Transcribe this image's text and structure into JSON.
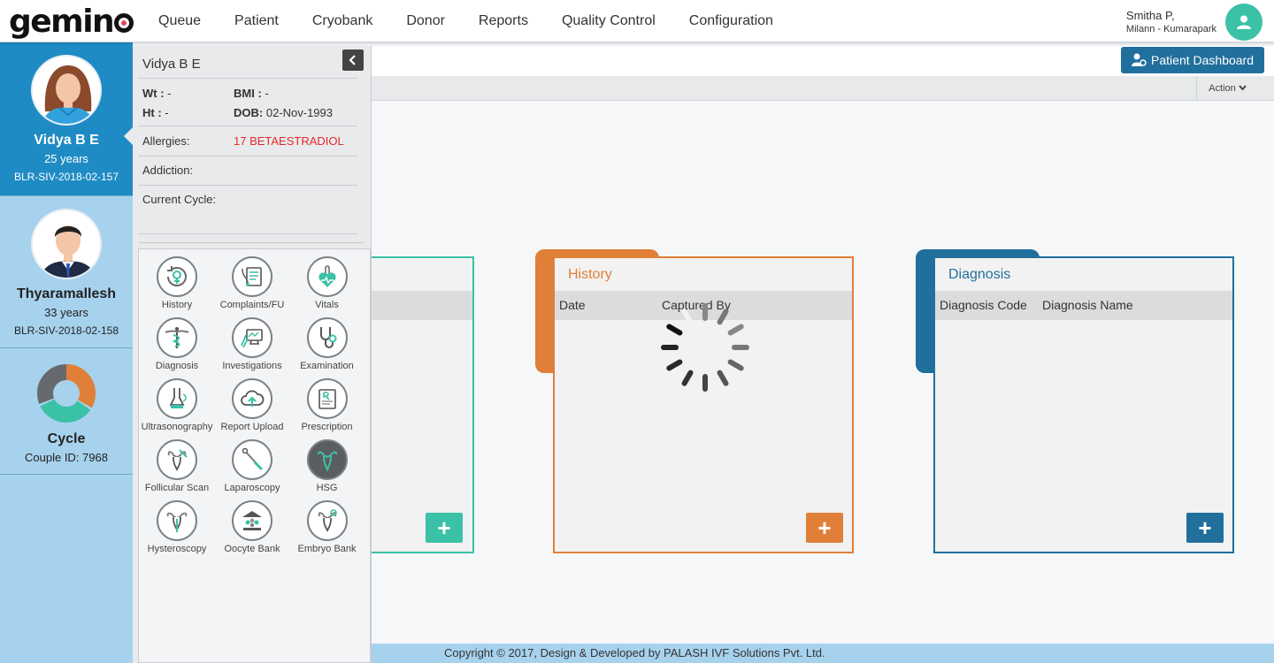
{
  "app": {
    "logo": "gemino"
  },
  "nav": [
    "Queue",
    "Patient",
    "Cryobank",
    "Donor",
    "Reports",
    "Quality Control",
    "Configuration"
  ],
  "user": {
    "name": "Smitha P,",
    "location": "Milann - Kumarapark"
  },
  "patients": [
    {
      "name": "Vidya B E",
      "age": "25 years",
      "id": "BLR-SIV-2018-02-157"
    },
    {
      "name": "Thyaramallesh",
      "age": "33 years",
      "id": "BLR-SIV-2018-02-158"
    }
  ],
  "cycle": {
    "label": "Cycle",
    "couple": "Couple ID: 7968"
  },
  "info": {
    "name": "Vidya B E",
    "wt_label": "Wt :",
    "wt_value": "-",
    "bmi_label": "BMI :",
    "bmi_value": "-",
    "ht_label": "Ht :",
    "ht_value": "-",
    "dob_label": "DOB:",
    "dob_value": "02-Nov-1993",
    "allergies_label": "Allergies:",
    "allergies_value": "17 BETAESTRADIOL",
    "addiction_label": "Addiction:",
    "cycle_label": "Current Cycle:"
  },
  "icons": [
    {
      "label": "History",
      "icon": "history-icon"
    },
    {
      "label": "Complaints/FU",
      "icon": "complaints-icon"
    },
    {
      "label": "Vitals",
      "icon": "vitals-icon"
    },
    {
      "label": "Diagnosis",
      "icon": "diagnosis-icon"
    },
    {
      "label": "Investigations",
      "icon": "investigations-icon"
    },
    {
      "label": "Examination",
      "icon": "examination-icon"
    },
    {
      "label": "Ultrasonography",
      "icon": "ultrasonography-icon"
    },
    {
      "label": "Report Upload",
      "icon": "report-upload-icon"
    },
    {
      "label": "Prescription",
      "icon": "prescription-icon"
    },
    {
      "label": "Follicular Scan",
      "icon": "follicular-scan-icon"
    },
    {
      "label": "Laparoscopy",
      "icon": "laparoscopy-icon"
    },
    {
      "label": "HSG",
      "icon": "hsg-icon"
    },
    {
      "label": "Hysteroscopy",
      "icon": "hysteroscopy-icon"
    },
    {
      "label": "Oocyte Bank",
      "icon": "oocyte-bank-icon"
    },
    {
      "label": "Embryo Bank",
      "icon": "embryo-bank-icon"
    }
  ],
  "toolbar": {
    "dashboard_label": "Patient Dashboard",
    "action_label": "Action"
  },
  "cards": {
    "history": {
      "title": "History",
      "col1": "Date",
      "col2": "Captured By",
      "add": "+"
    },
    "diagnosis": {
      "title": "Diagnosis",
      "col1": "Diagnosis Code",
      "col2": "Diagnosis Name",
      "add": "+"
    },
    "left": {
      "add": "+"
    }
  },
  "colors": {
    "teal": "#3bc1a6",
    "orange": "#e07f37",
    "blue": "#216f9d",
    "sidebar": "#a7d2ee",
    "active": "#1f8bc4",
    "allergy": "#e32a2a"
  },
  "footer": "Copyright © 2017, Design & Developed by PALASH IVF Solutions Pvt. Ltd."
}
